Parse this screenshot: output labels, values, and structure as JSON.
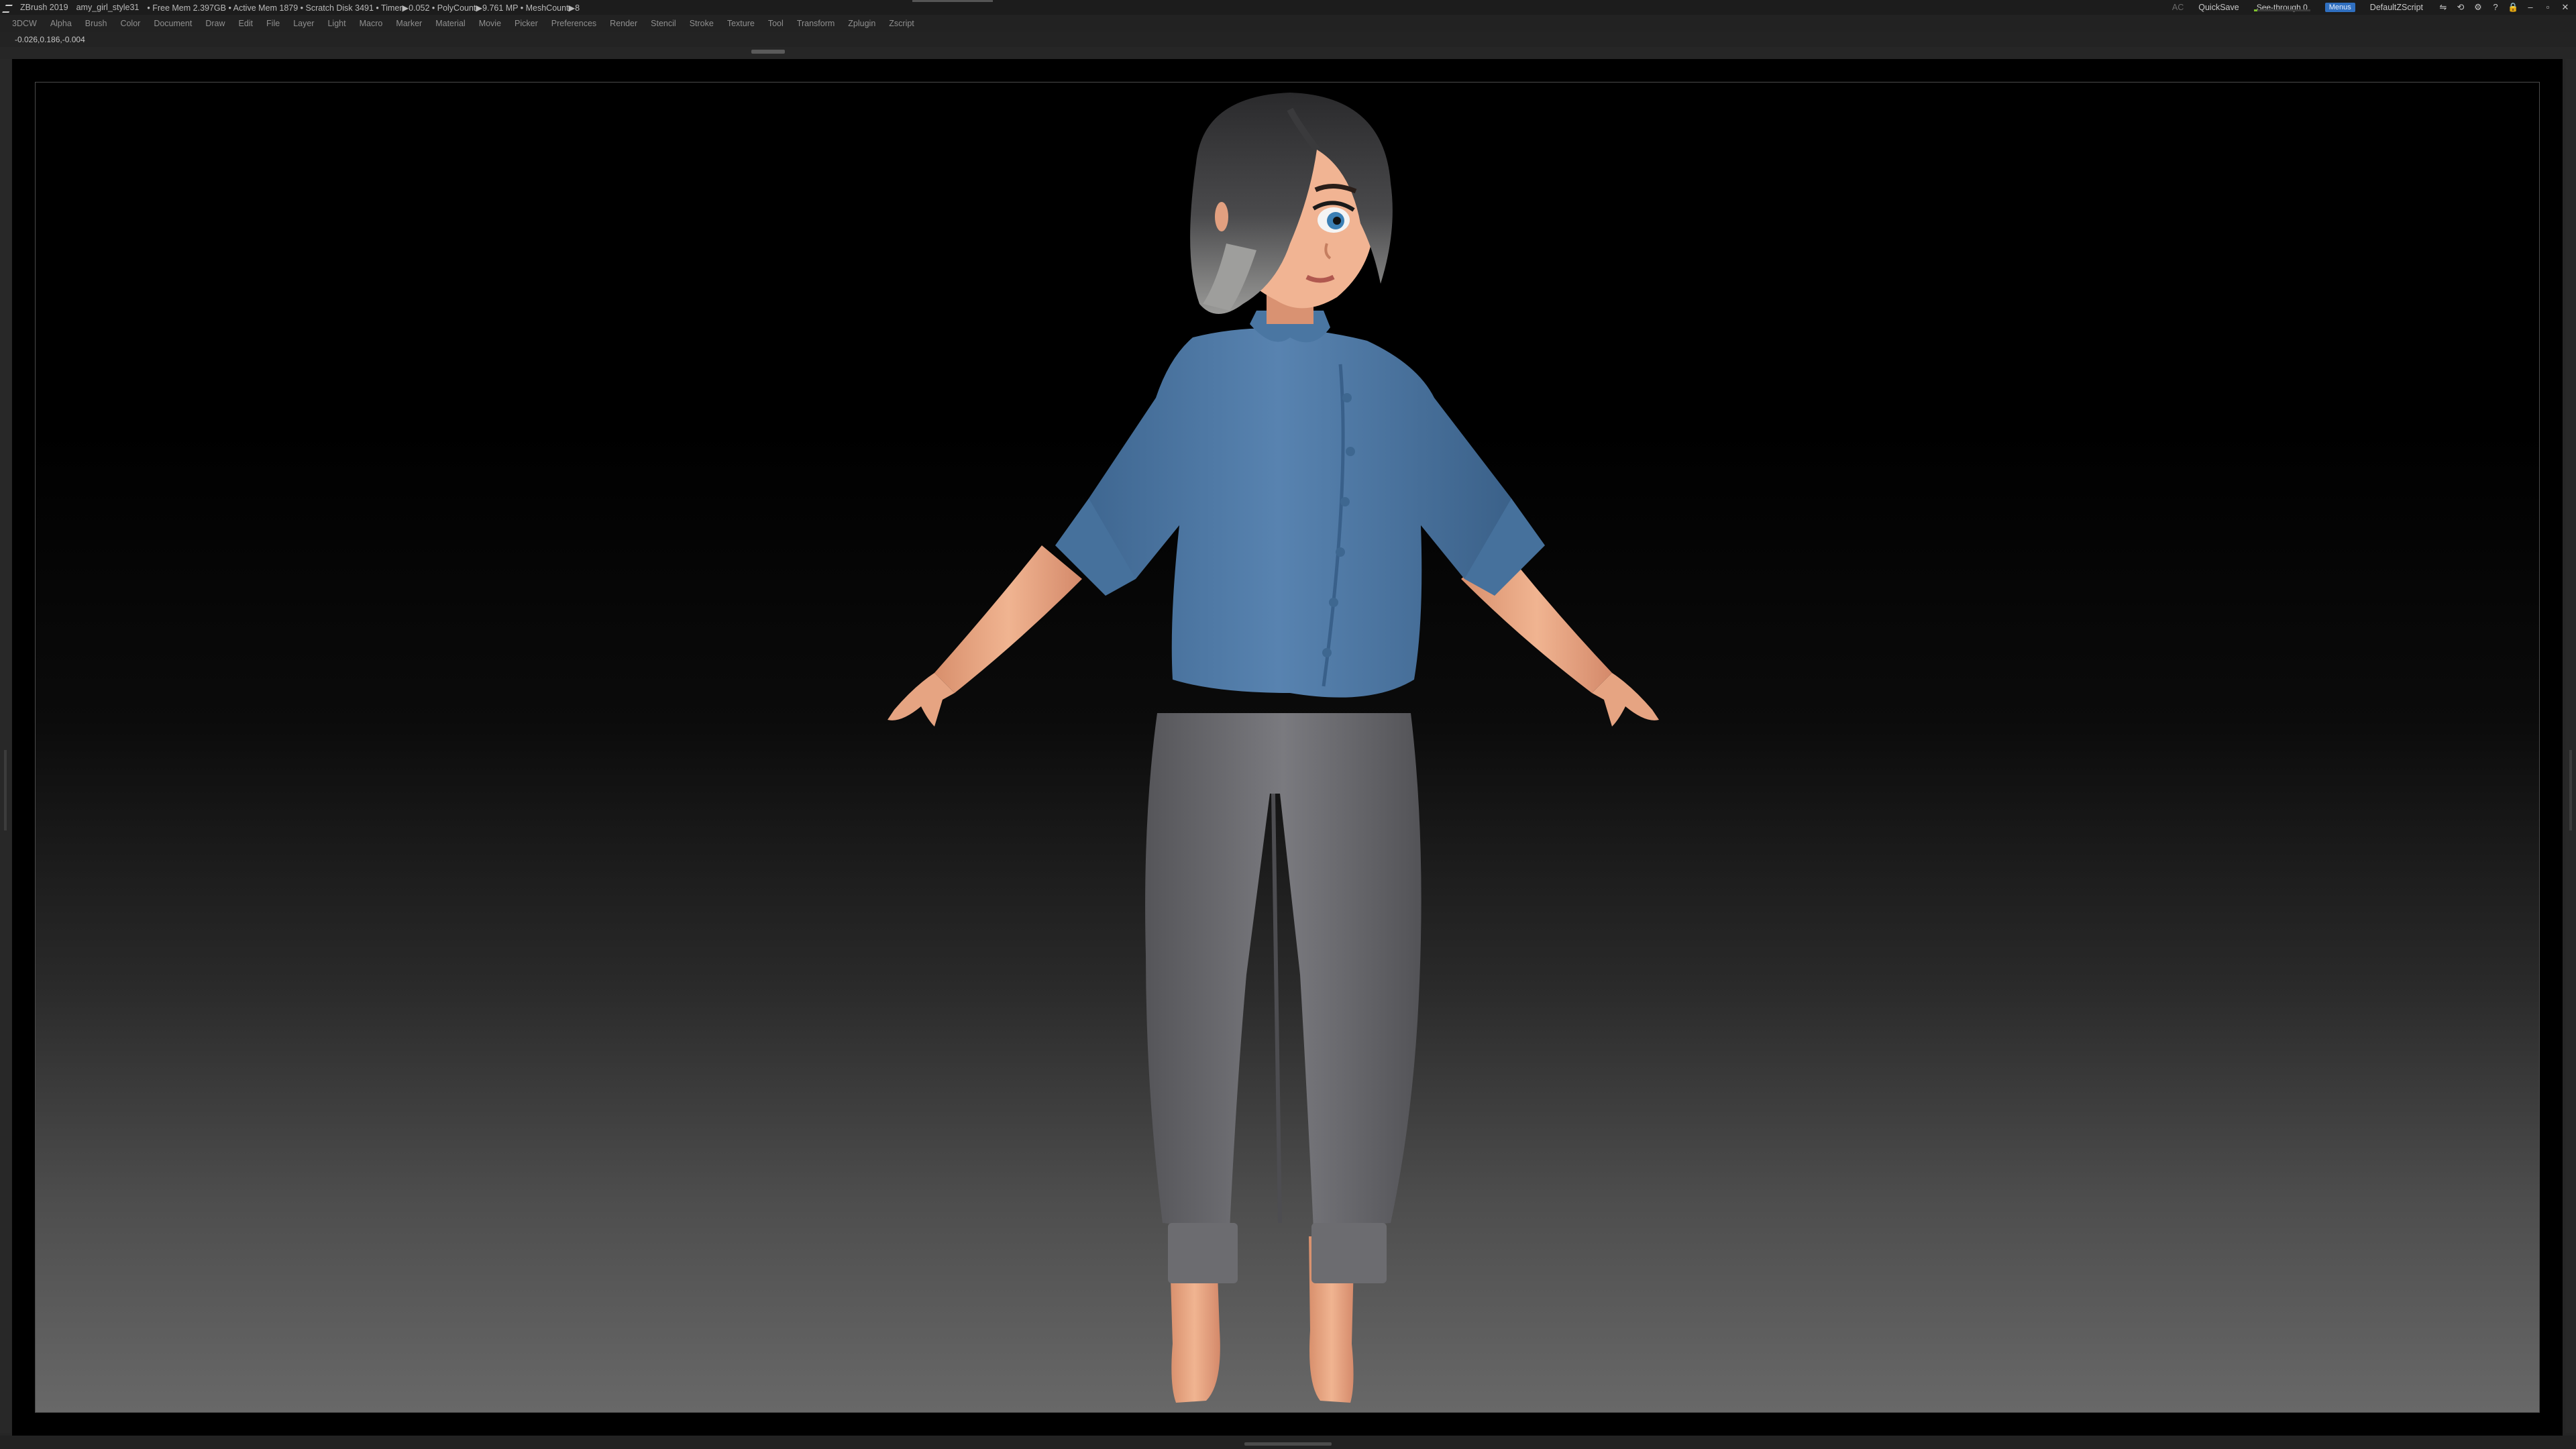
{
  "titlebar": {
    "app_name": "ZBrush 2019",
    "file_name": "amy_girl_style31",
    "stats": "• Free Mem 2.397GB • Active Mem 1879 • Scratch Disk 3491 • Timer▶0.052 • PolyCount▶9.761 MP • MeshCount▶8",
    "ac_label": "AC",
    "quicksave_label": "QuickSave",
    "seethrough_label": "See-through  0",
    "seethrough_value": 0,
    "menus_label": "Menus",
    "zscript_label": "DefaultZScript"
  },
  "menubar": {
    "items": [
      "3DCW",
      "Alpha",
      "Brush",
      "Color",
      "Document",
      "Draw",
      "Edit",
      "File",
      "Layer",
      "Light",
      "Macro",
      "Marker",
      "Material",
      "Movie",
      "Picker",
      "Preferences",
      "Render",
      "Stencil",
      "Stroke",
      "Texture",
      "Tool",
      "Transform",
      "Zplugin",
      "Zscript"
    ]
  },
  "status": {
    "coordinates": "-0.026,0.186,-0.004"
  },
  "colors": {
    "accent": "#2f6fc0",
    "seethrough_fill": "#7fc12e",
    "shirt": "#4f7aa6",
    "pants": "#6e6e72",
    "skin": "#e8a785",
    "hair": "#2b2b2d"
  }
}
